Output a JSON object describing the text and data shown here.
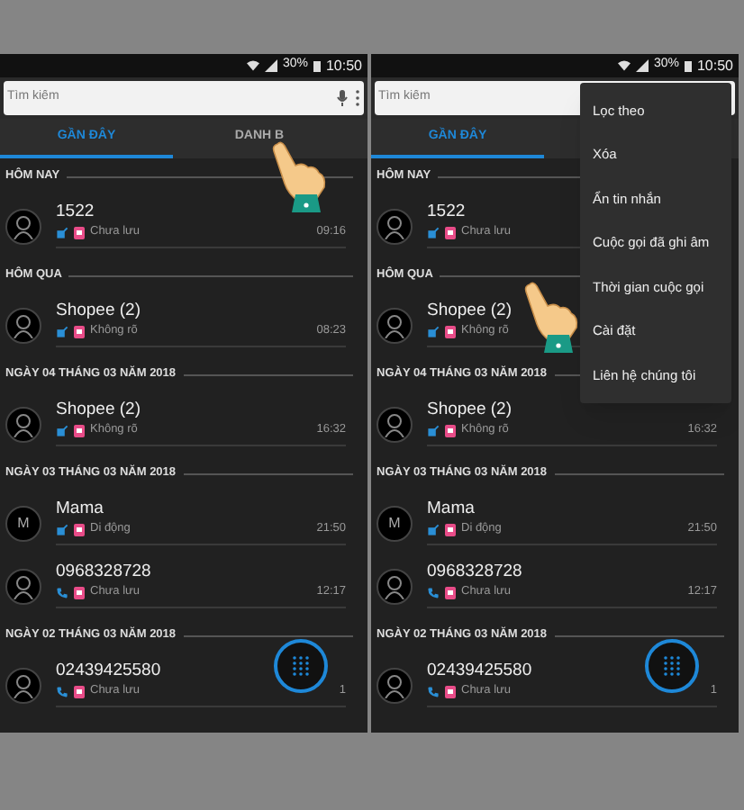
{
  "screens": [
    {
      "status_bar": {
        "battery": "30%",
        "time": "10:50"
      },
      "search": {
        "placeholder": "Tìm kiếm"
      },
      "tabs": [
        {
          "label": "GẦN ĐÂY",
          "selected": true
        },
        {
          "label": "DANH B",
          "selected": false
        }
      ],
      "sections": [
        {
          "title": "HÔM NAY",
          "calls": [
            {
              "name": "1522",
              "kind": "other",
              "label": "Chưa lưu",
              "time": "09:16"
            }
          ]
        },
        {
          "title": "HÔM QUA",
          "calls": [
            {
              "name": "Shopee (2)",
              "kind": "other",
              "label": "Không rõ",
              "time": "08:23"
            }
          ]
        },
        {
          "title": "NGÀY 04 THÁNG 03 NĂM 2018",
          "calls": [
            {
              "name": "Shopee (2)",
              "kind": "other",
              "label": "Không rõ",
              "time": "16:32"
            }
          ]
        },
        {
          "title": "NGÀY 03 THÁNG 03 NĂM 2018",
          "calls": [
            {
              "name": "Mama",
              "avatar_letter": "M",
              "kind": "other",
              "label": "Di động",
              "time": "21:50"
            },
            {
              "name": "0968328728",
              "kind": "call",
              "label": "Chưa lưu",
              "time": "12:17"
            }
          ]
        },
        {
          "title": "NGÀY 02 THÁNG 03 NĂM 2018",
          "calls": [
            {
              "name": "02439425580",
              "kind": "call",
              "label": "Chưa lưu",
              "time": "1"
            }
          ]
        }
      ]
    },
    {
      "status_bar": {
        "battery": "30%",
        "time": "10:50"
      },
      "search": {
        "placeholder": "Tìm kiếm"
      },
      "tabs": [
        {
          "label": "GẦN ĐÂY",
          "selected": true
        }
      ],
      "sections": [
        {
          "title": "HÔM NAY",
          "calls": [
            {
              "name": "1522",
              "kind": "other",
              "label": "Chưa lưu"
            }
          ]
        },
        {
          "title": "HÔM QUA",
          "calls": [
            {
              "name": "Shopee (2)",
              "kind": "other",
              "label": "Không rõ"
            }
          ]
        },
        {
          "title": "NGÀY 04 THÁNG 03 NĂM 2018",
          "calls": [
            {
              "name": "Shopee (2)",
              "kind": "other",
              "label": "Không rõ",
              "time": "16:32"
            }
          ]
        },
        {
          "title": "NGÀY 03 THÁNG 03 NĂM 2018",
          "calls": [
            {
              "name": "Mama",
              "avatar_letter": "M",
              "kind": "other",
              "label": "Di động",
              "time": "21:50"
            },
            {
              "name": "0968328728",
              "kind": "call",
              "label": "Chưa lưu",
              "time": "12:17"
            }
          ]
        },
        {
          "title": "NGÀY 02 THÁNG 03 NĂM 2018",
          "calls": [
            {
              "name": "02439425580",
              "kind": "call",
              "label": "Chưa lưu",
              "time": "1"
            }
          ]
        }
      ],
      "menu": [
        "Lọc theo",
        "Xóa",
        "Ẩn tin nhắn",
        "Cuộc gọi đã ghi âm",
        "Thời gian cuộc gọi",
        "Cài đặt",
        "Liên hệ chúng tôi"
      ]
    }
  ]
}
